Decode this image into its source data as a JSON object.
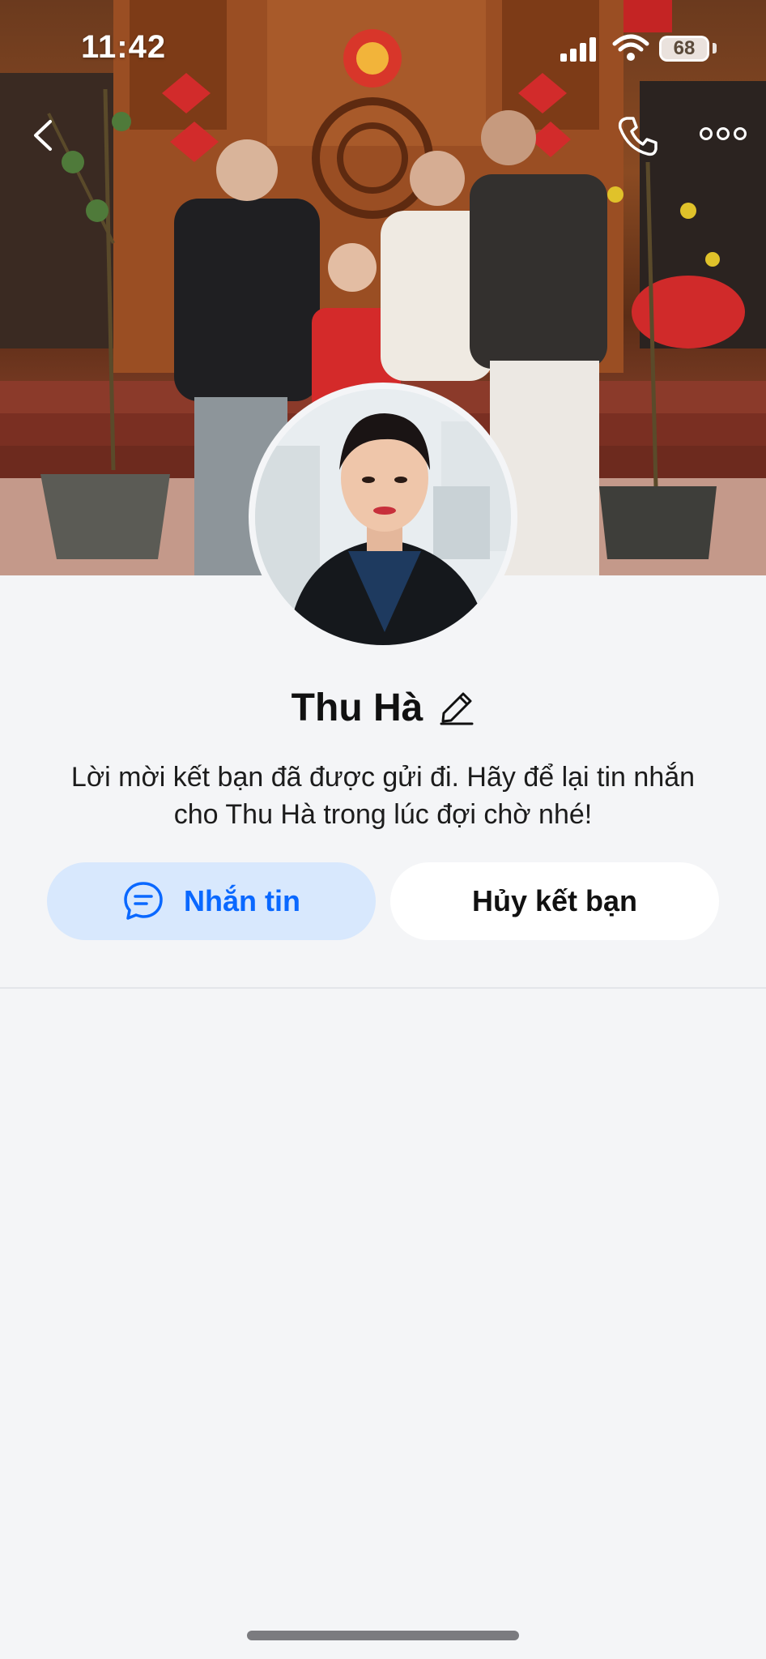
{
  "status_bar": {
    "time": "11:42",
    "battery": "68",
    "icons": [
      "signal-icon",
      "wifi-icon",
      "battery-icon"
    ]
  },
  "nav": {
    "icons": [
      "chevron-left-icon",
      "phone-icon",
      "more-icon"
    ]
  },
  "profile": {
    "name": "Thu Hà",
    "message": "Lời mời kết bạn đã được gửi đi. Hãy để lại tin nhắn cho Thu Hà trong lúc đợi chờ nhé!"
  },
  "actions": {
    "message_label": "Nhắn tin",
    "unfriend_label": "Hủy kết bạn"
  },
  "colors": {
    "accent": "#0a68ff",
    "accent_bg": "#d8e8fd",
    "page_bg": "#f4f5f7"
  }
}
